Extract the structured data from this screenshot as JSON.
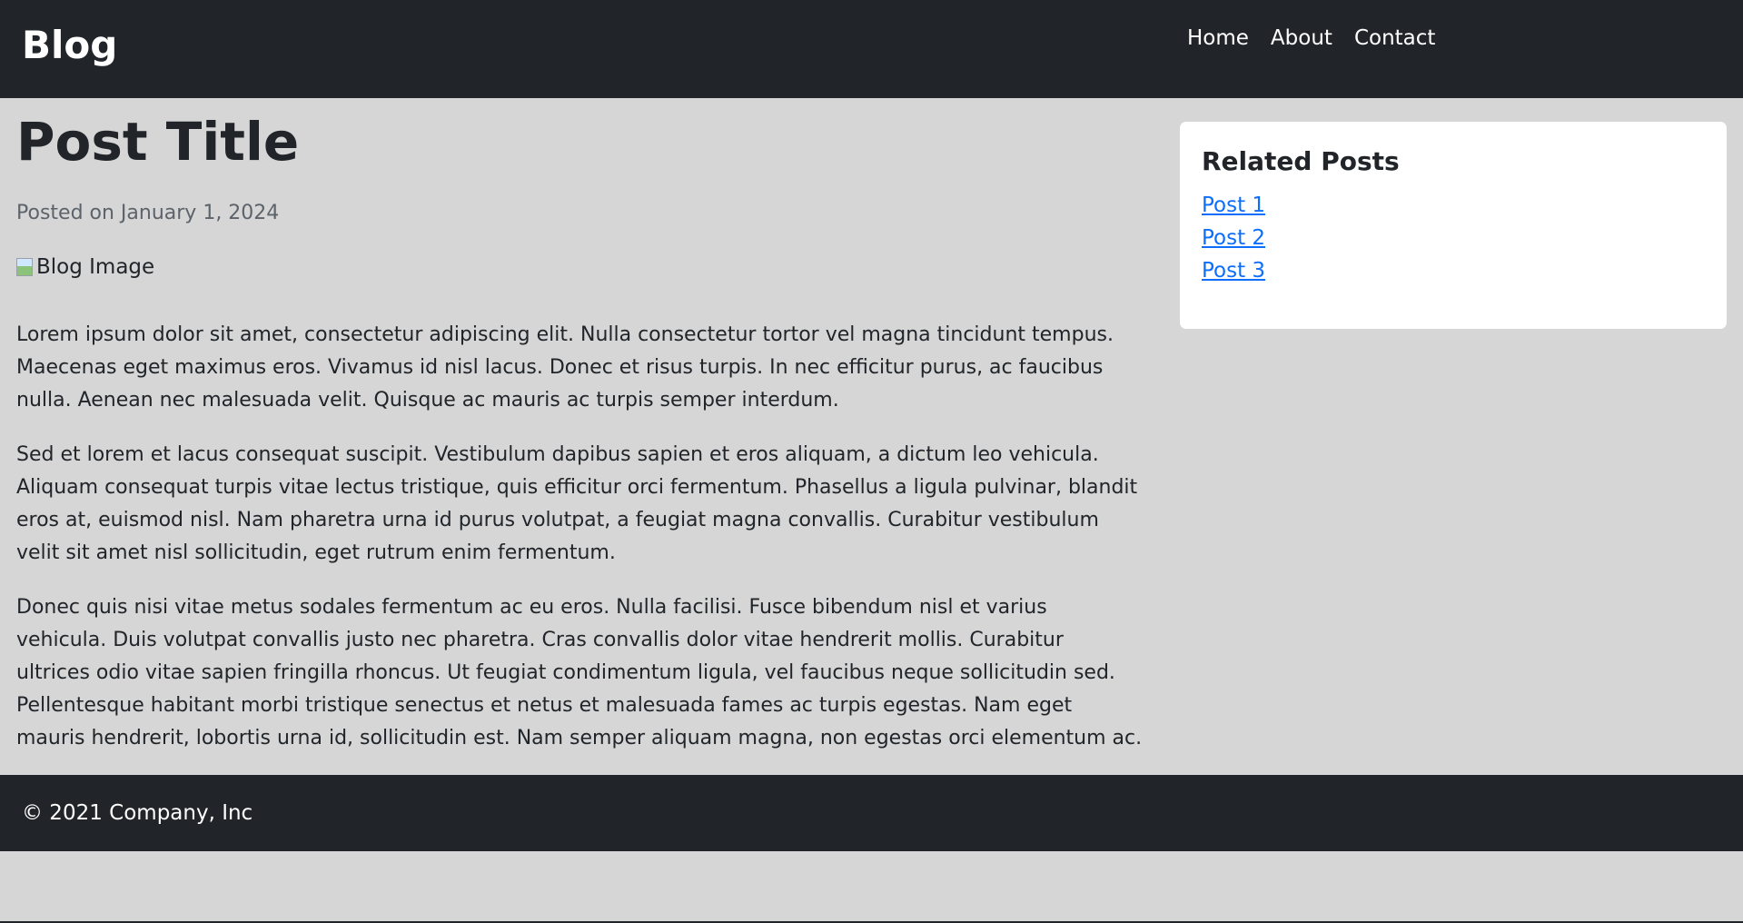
{
  "navbar": {
    "brand": "Blog",
    "links": [
      "Home",
      "About",
      "Contact"
    ]
  },
  "post": {
    "title": "Post Title",
    "meta": "Posted on January 1, 2024",
    "image_alt": "Blog Image",
    "paragraphs": [
      "Lorem ipsum dolor sit amet, consectetur adipiscing elit. Nulla consectetur tortor vel magna tincidunt tempus. Maecenas eget maximus eros. Vivamus id nisl lacus. Donec et risus turpis. In nec efficitur purus, ac faucibus nulla. Aenean nec malesuada velit. Quisque ac mauris ac turpis semper interdum.",
      "Sed et lorem et lacus consequat suscipit. Vestibulum dapibus sapien et eros aliquam, a dictum leo vehicula. Aliquam consequat turpis vitae lectus tristique, quis efficitur orci fermentum. Phasellus a ligula pulvinar, blandit eros at, euismod nisl. Nam pharetra urna id purus volutpat, a feugiat magna convallis. Curabitur vestibulum velit sit amet nisl sollicitudin, eget rutrum enim fermentum.",
      "Donec quis nisi vitae metus sodales fermentum ac eu eros. Nulla facilisi. Fusce bibendum nisl et varius vehicula. Duis volutpat convallis justo nec pharetra. Cras convallis dolor vitae hendrerit mollis. Curabitur ultrices odio vitae sapien fringilla rhoncus. Ut feugiat condimentum ligula, vel faucibus neque sollicitudin sed. Pellentesque habitant morbi tristique senectus et netus et malesuada fames ac turpis egestas. Nam eget mauris hendrerit, lobortis urna id, sollicitudin est. Nam semper aliquam magna, non egestas orci elementum ac."
    ]
  },
  "sidebar": {
    "title": "Related Posts",
    "links": [
      "Post 1",
      "Post 2",
      "Post 3"
    ]
  },
  "footer": {
    "text": "© 2021 Company, Inc"
  },
  "colors": {
    "navbar_bg": "#212529",
    "page_bg": "#d6d6d6",
    "link": "#0d6efd"
  }
}
